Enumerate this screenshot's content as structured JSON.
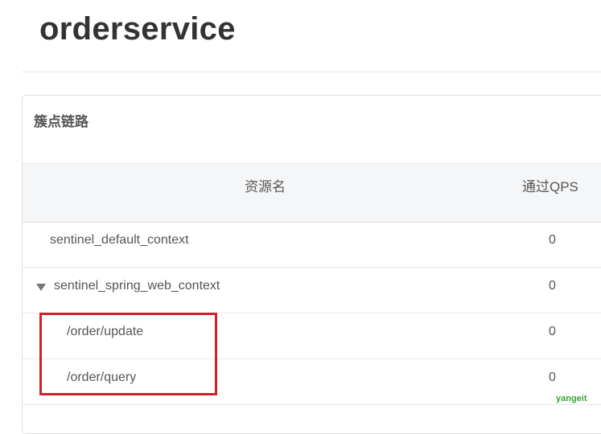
{
  "page": {
    "title": "orderservice"
  },
  "panel": {
    "heading": "簇点链路",
    "columns": {
      "resource_name": "资源名",
      "pass_qps": "通过QPS"
    },
    "rows": [
      {
        "name": "sentinel_default_context",
        "qps": "0",
        "expandable": false
      },
      {
        "name": "sentinel_spring_web_context",
        "qps": "0",
        "expandable": true,
        "expanded": true
      },
      {
        "name": "/order/update",
        "qps": "0",
        "level": 1
      },
      {
        "name": "/order/query",
        "qps": "0",
        "level": 1
      }
    ]
  },
  "highlight": {
    "color": "#d0202a"
  },
  "watermark": {
    "text": "yangeit"
  }
}
